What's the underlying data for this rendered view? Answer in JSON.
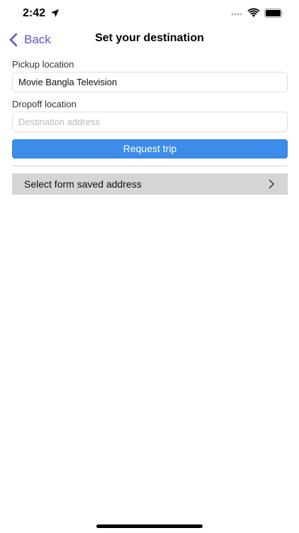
{
  "status_bar": {
    "time": "2:42"
  },
  "nav": {
    "back_label": "Back",
    "title": "Set your destination",
    "accent_color": "#5a55c8"
  },
  "form": {
    "pickup_label": "Pickup location",
    "pickup_value": "Movie Bangla Television",
    "dropoff_label": "Dropoff location",
    "dropoff_placeholder": "Destination address",
    "dropoff_value": "",
    "request_label": "Request trip",
    "request_color": "#3c8cea",
    "saved_address_label": "Select form saved address"
  },
  "icons": [
    "location-arrow-icon",
    "signal-dots-icon",
    "wifi-icon",
    "battery-icon",
    "back-chevron-icon",
    "chevron-right-icon"
  ]
}
